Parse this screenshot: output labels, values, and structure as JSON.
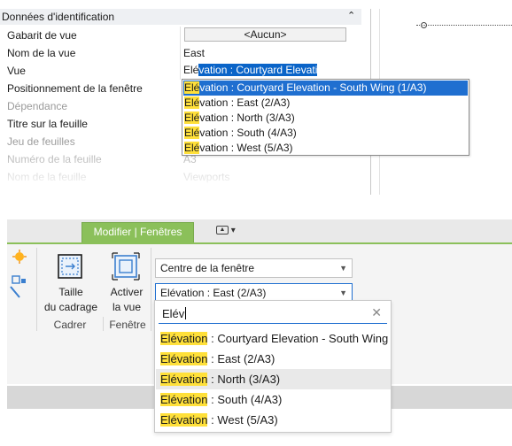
{
  "properties": {
    "section_title": "Données d'identification",
    "collapse_icon": "double-chevron-up",
    "rows": [
      {
        "label": "Gabarit de vue",
        "value": "<Aucun>"
      },
      {
        "label": "Nom de la vue",
        "value": "East"
      },
      {
        "label": "Vue",
        "value_prefix": "Elé",
        "value_selected": "vation : Courtyard Elevati"
      },
      {
        "label": "Positionnement de la fenêtre"
      },
      {
        "label": "Dépendance"
      },
      {
        "label": "Titre sur la feuille"
      },
      {
        "label": "Jeu de feuilles"
      },
      {
        "label": "Numéro de la feuille",
        "value": "A3"
      },
      {
        "label": "Nom de la feuille",
        "value": "Viewports"
      }
    ],
    "dropdown": {
      "items": [
        {
          "match": "Elé",
          "rest": "vation : Courtyard Elevation - South Wing (1/A3)",
          "selected": true
        },
        {
          "match": "Elé",
          "rest": "vation : East (2/A3)"
        },
        {
          "match": "Elé",
          "rest": "vation : North (3/A3)"
        },
        {
          "match": "Elé",
          "rest": "vation : South (4/A3)"
        },
        {
          "match": "Elé",
          "rest": "vation : West (5/A3)"
        }
      ]
    }
  },
  "ribbon": {
    "active_tab": "Modifier | Fenêtres",
    "tab_control_icon": "panel-toggle-icon",
    "buttons": {
      "crop_size": {
        "line1": "Taille",
        "line2": "du cadrage"
      },
      "activate_view": {
        "line1": "Activer",
        "line2": "la vue"
      }
    },
    "panels": {
      "frame": "Cadrer",
      "window": "Fenêtre"
    },
    "combo_position": "Centre de la fenêtre",
    "combo_view": "Elévation : East (2/A3)",
    "search_text": "Elév",
    "list": [
      {
        "match": "Elévation",
        "rest": " : Courtyard Elevation - South Wing"
      },
      {
        "match": "Elévation",
        "rest": " : East (2/A3)"
      },
      {
        "match": "Elévation",
        "rest": " : North (3/A3)",
        "hover": true
      },
      {
        "match": "Elévation",
        "rest": " : South (4/A3)"
      },
      {
        "match": "Elévation",
        "rest": " : West (5/A3)"
      }
    ]
  },
  "colors": {
    "tab_green": "#8bc05a",
    "selection_blue": "#1f6fd0",
    "highlight_yellow": "#ffe03a"
  }
}
